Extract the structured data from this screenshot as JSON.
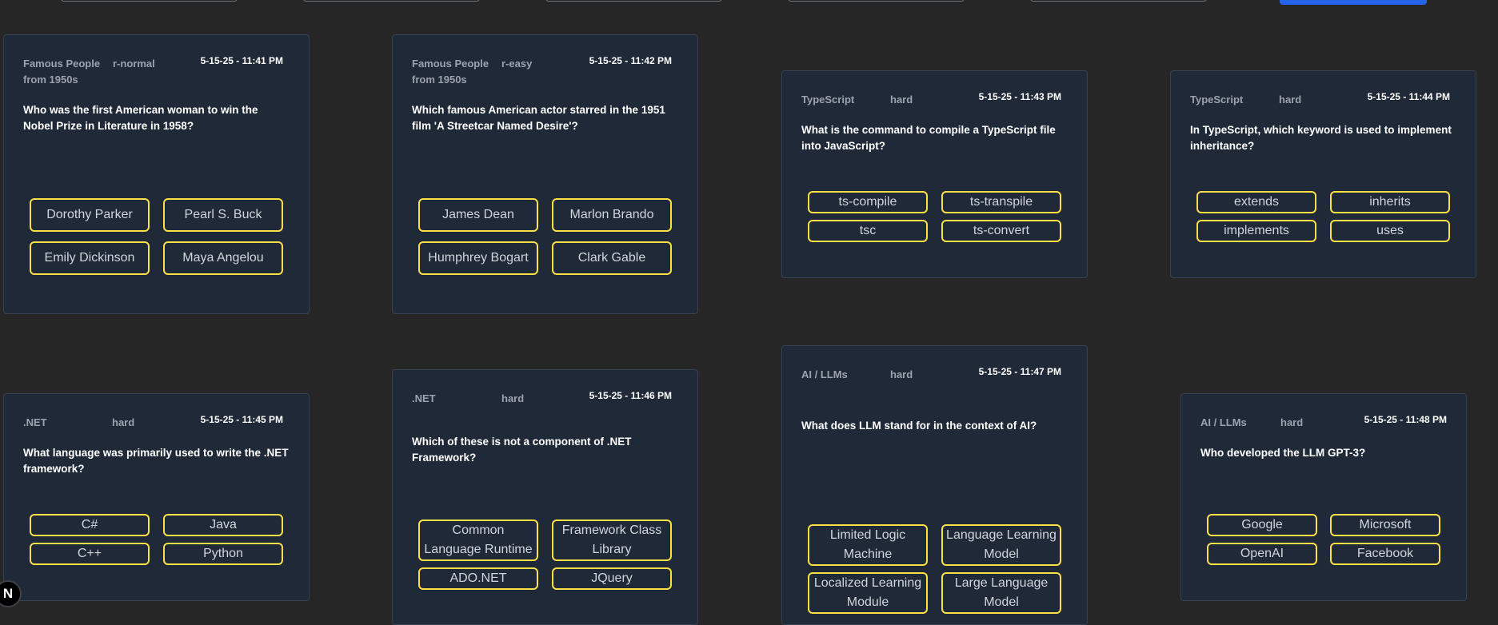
{
  "colors": {
    "page_background": "#262626",
    "card_background": "#1f2937",
    "card_border": "#374151",
    "answer_border": "#fde047",
    "answer_text": "#d1d5db",
    "meta_text": "#9ca3af",
    "question_text": "#ffffff",
    "accent": "#2563eb"
  },
  "cards": [
    {
      "category": "Famous People from 1950s",
      "difficulty": "r-normal",
      "timestamp": "5-15-25 - 11:41 PM",
      "question": "Who was the first American woman to win the Nobel Prize in Literature in 1958?",
      "answers": [
        "Dorothy Parker",
        "Pearl S. Buck",
        "Emily Dickinson",
        "Maya Angelou"
      ]
    },
    {
      "category": "Famous People from 1950s",
      "difficulty": "r-easy",
      "timestamp": "5-15-25 - 11:42 PM",
      "question": "Which famous American actor starred in the 1951 film 'A Streetcar Named Desire'?",
      "answers": [
        "James Dean",
        "Marlon Brando",
        "Humphrey Bogart",
        "Clark Gable"
      ]
    },
    {
      "category": "TypeScript",
      "difficulty": "hard",
      "timestamp": "5-15-25 - 11:43 PM",
      "question": "What is the command to compile a TypeScript file into JavaScript?",
      "answers": [
        "ts-compile",
        "ts-transpile",
        "tsc",
        "ts-convert"
      ]
    },
    {
      "category": "TypeScript",
      "difficulty": "hard",
      "timestamp": "5-15-25 - 11:44 PM",
      "question": "In TypeScript, which keyword is used to implement inheritance?",
      "answers": [
        "extends",
        "inherits",
        "implements",
        "uses"
      ]
    },
    {
      "category": ".NET",
      "difficulty": "hard",
      "timestamp": "5-15-25 - 11:45 PM",
      "question": "What language was primarily used to write the .NET framework?",
      "answers": [
        "C#",
        "Java",
        "C++",
        "Python"
      ]
    },
    {
      "category": ".NET",
      "difficulty": "hard",
      "timestamp": "5-15-25 - 11:46 PM",
      "question": "Which of these is not a component of .NET Framework?",
      "answers": [
        "Common Language Runtime",
        "Framework Class Library",
        "ADO.NET",
        "JQuery"
      ]
    },
    {
      "category": "AI / LLMs",
      "difficulty": "hard",
      "timestamp": "5-15-25 - 11:47 PM",
      "question": "What does LLM stand for in the context of AI?",
      "answers": [
        "Limited Logic Machine",
        "Language Learning Model",
        "Localized Learning Module",
        "Large Language Model"
      ]
    },
    {
      "category": "AI / LLMs",
      "difficulty": "hard",
      "timestamp": "5-15-25 - 11:48 PM",
      "question": "Who developed the LLM GPT-3?",
      "answers": [
        "Google",
        "Microsoft",
        "OpenAI",
        "Facebook"
      ]
    }
  ],
  "badge": {
    "letter": "N"
  }
}
